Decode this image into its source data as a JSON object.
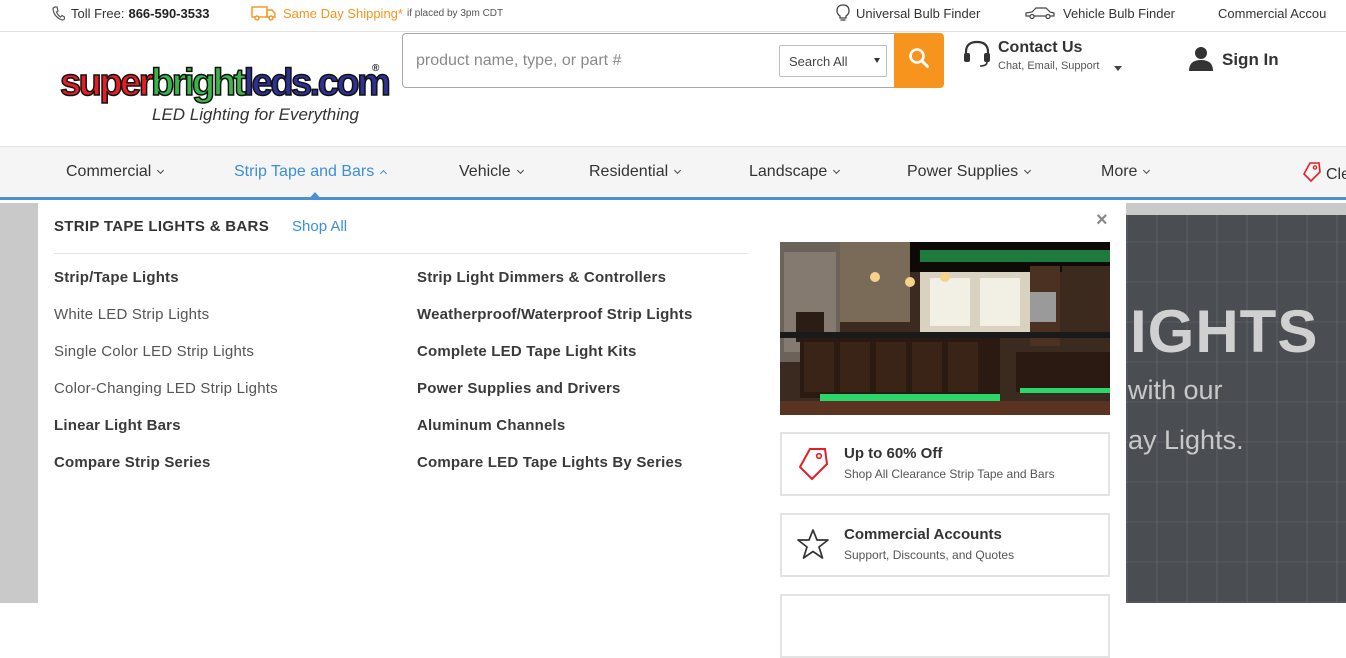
{
  "topbar": {
    "toll_label": "Toll Free:",
    "toll_number": "866-590-3533",
    "shipping_label": "Same Day Shipping*",
    "shipping_note": "if placed by 3pm CDT",
    "universal_finder": "Universal Bulb Finder",
    "vehicle_finder": "Vehicle Bulb Finder",
    "commercial_accounts": "Commercial Accou"
  },
  "header": {
    "logo_part1": "super",
    "logo_part2": "bright",
    "logo_part3": "leds.com",
    "logo_reg": "®",
    "tagline": "LED Lighting for Everything",
    "search_placeholder": "product name, type, or part #",
    "search_scope": "Search All",
    "contact_title": "Contact Us",
    "contact_sub": "Chat, Email, Support",
    "signin": "Sign In"
  },
  "nav": {
    "items": [
      "Commercial",
      "Strip Tape and Bars",
      "Vehicle",
      "Residential",
      "Landscape",
      "Power Supplies",
      "More"
    ],
    "clearance_partial": "Cle"
  },
  "dropdown": {
    "title": "STRIP TAPE LIGHTS & BARS",
    "shop_all": "Shop All",
    "close": "×",
    "left_links": [
      "Strip/Tape Lights",
      "White LED Strip Lights",
      "Single Color LED Strip Lights",
      "Color-Changing LED Strip Lights",
      "Linear Light Bars",
      "Compare Strip Series"
    ],
    "right_links": [
      "Strip Light Dimmers & Controllers",
      "Weatherproof/Waterproof Strip Lights",
      "Complete LED Tape Light Kits",
      "Power Supplies and Drivers",
      "Aluminum Channels",
      "Compare LED Tape Lights By Series"
    ],
    "promo1_title": "Up to 60% Off",
    "promo1_sub": "Shop All Clearance Strip Tape and Bars",
    "promo2_title": "Commercial Accounts",
    "promo2_sub": "Support, Discounts, and Quotes"
  },
  "hero": {
    "big": "IGHTS",
    "line1": "with our",
    "line2": "ay Lights."
  },
  "colors": {
    "accent_orange": "#f7941d",
    "link_blue": "#3b8ed9",
    "nav_border": "#4a90d9",
    "strip_green": "#2bd66b"
  }
}
